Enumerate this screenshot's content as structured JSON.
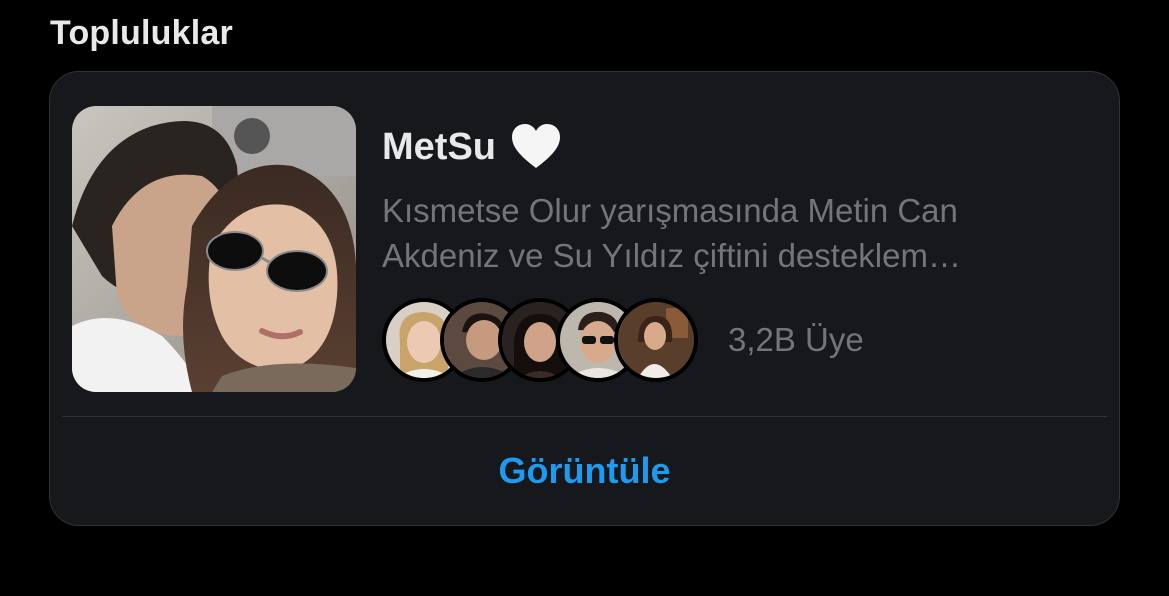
{
  "section": {
    "title": "Topluluklar"
  },
  "community": {
    "name": "MetSu",
    "icon": "white-heart-icon",
    "description": "Kısmetse Olur yarışmasında Metin Can Akdeniz ve Su Yıldız çiftini desteklem…",
    "member_count": "3,2B Üye",
    "member_avatar_count": 5,
    "view_label": "Görüntüle"
  },
  "colors": {
    "background": "#000000",
    "card": "#16181c",
    "border": "#2f3336",
    "primary_text": "#e7e9ea",
    "secondary_text": "#71767b",
    "accent": "#1d9bf0"
  }
}
